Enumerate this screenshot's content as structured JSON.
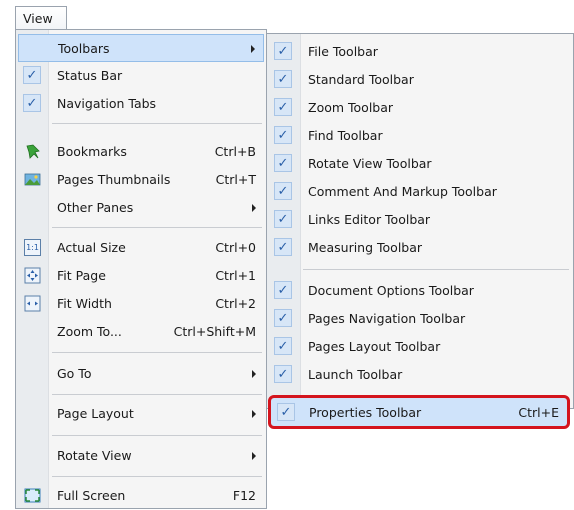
{
  "menubar": {
    "view_label": "View"
  },
  "main_menu": {
    "toolbars": "Toolbars",
    "status_bar": "Status Bar",
    "navigation_tabs": "Navigation Tabs",
    "bookmarks": "Bookmarks",
    "bookmarks_sc": "Ctrl+B",
    "pages_thumbnails": "Pages Thumbnails",
    "pages_thumbnails_sc": "Ctrl+T",
    "other_panes": "Other Panes",
    "actual_size": "Actual Size",
    "actual_size_sc": "Ctrl+0",
    "actual_size_icon": "1:1",
    "fit_page": "Fit Page",
    "fit_page_sc": "Ctrl+1",
    "fit_width": "Fit Width",
    "fit_width_sc": "Ctrl+2",
    "zoom_to": "Zoom To...",
    "zoom_to_sc": "Ctrl+Shift+M",
    "go_to": "Go To",
    "page_layout": "Page Layout",
    "rotate_view": "Rotate View",
    "full_screen": "Full Screen",
    "full_screen_sc": "F12"
  },
  "toolbars_menu": {
    "file": "File Toolbar",
    "standard": "Standard Toolbar",
    "zoom": "Zoom Toolbar",
    "find": "Find Toolbar",
    "rotate_view": "Rotate View Toolbar",
    "comment_markup": "Comment And Markup Toolbar",
    "links_editor": "Links Editor Toolbar",
    "measuring": "Measuring Toolbar",
    "document_options": "Document Options Toolbar",
    "pages_navigation": "Pages Navigation Toolbar",
    "pages_layout": "Pages Layout Toolbar",
    "launch": "Launch Toolbar",
    "properties": "Properties Toolbar",
    "properties_sc": "Ctrl+E"
  },
  "check_glyph": "✓",
  "colors": {
    "highlight_border": "#d4141d",
    "hover_bg": "#cfe3fa"
  }
}
